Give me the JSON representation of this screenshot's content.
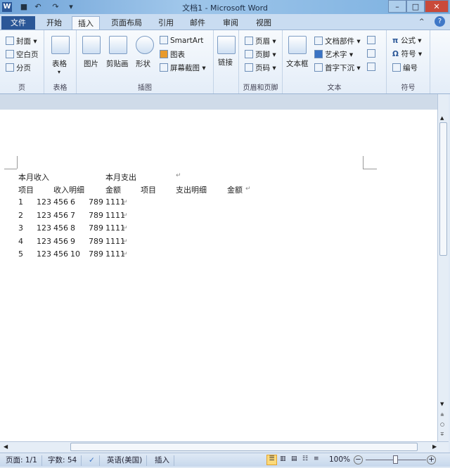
{
  "window": {
    "title": "文档1 - Microsoft Word",
    "app_icon": "W"
  },
  "quick_access": [
    "save-icon",
    "undo-icon",
    "redo-icon",
    "customize-icon"
  ],
  "tabs": [
    {
      "label": "文件"
    },
    {
      "label": "开始"
    },
    {
      "label": "插入"
    },
    {
      "label": "页面布局"
    },
    {
      "label": "引用"
    },
    {
      "label": "邮件"
    },
    {
      "label": "审阅"
    },
    {
      "label": "视图"
    }
  ],
  "ribbon": {
    "page": {
      "label": "页",
      "items": [
        "封面",
        "空白页",
        "分页"
      ]
    },
    "table": {
      "label": "表格",
      "items": [
        "表格"
      ]
    },
    "illustrations": {
      "label": "插图",
      "items": [
        "图片",
        "剪贴画",
        "形状",
        "SmartArt",
        "图表",
        "屏幕截图"
      ]
    },
    "links": {
      "label": "",
      "items": [
        "链接"
      ]
    },
    "header_footer": {
      "label": "页眉和页脚",
      "items": [
        "页眉",
        "页脚",
        "页码"
      ]
    },
    "text": {
      "label": "文本",
      "items": [
        "文本框",
        "文档部件",
        "艺术字",
        "首字下沉"
      ]
    },
    "symbols": {
      "label": "符号",
      "items": [
        "公式",
        "符号",
        "编号"
      ]
    }
  },
  "document": {
    "line1": {
      "a": "本月收入",
      "b": "本月支出"
    },
    "headers": [
      "项目",
      "收入明细",
      "金额",
      "项目",
      "支出明细",
      "金额"
    ],
    "rows": [
      [
        "1",
        "123",
        "456",
        "6",
        "789",
        "1111"
      ],
      [
        "2",
        "123",
        "456",
        "7",
        "789",
        "1111"
      ],
      [
        "3",
        "123",
        "456",
        "8",
        "789",
        "1111"
      ],
      [
        "4",
        "123",
        "456",
        "9",
        "789",
        "1111"
      ],
      [
        "5",
        "123",
        "456",
        "10",
        "789",
        "1111"
      ]
    ],
    "para_mark": "↵"
  },
  "status": {
    "page": "页面: 1/1",
    "words": "字数: 54",
    "language": "英语(美国)",
    "mode": "插入",
    "zoom": "100%",
    "zoom_level": 100
  }
}
